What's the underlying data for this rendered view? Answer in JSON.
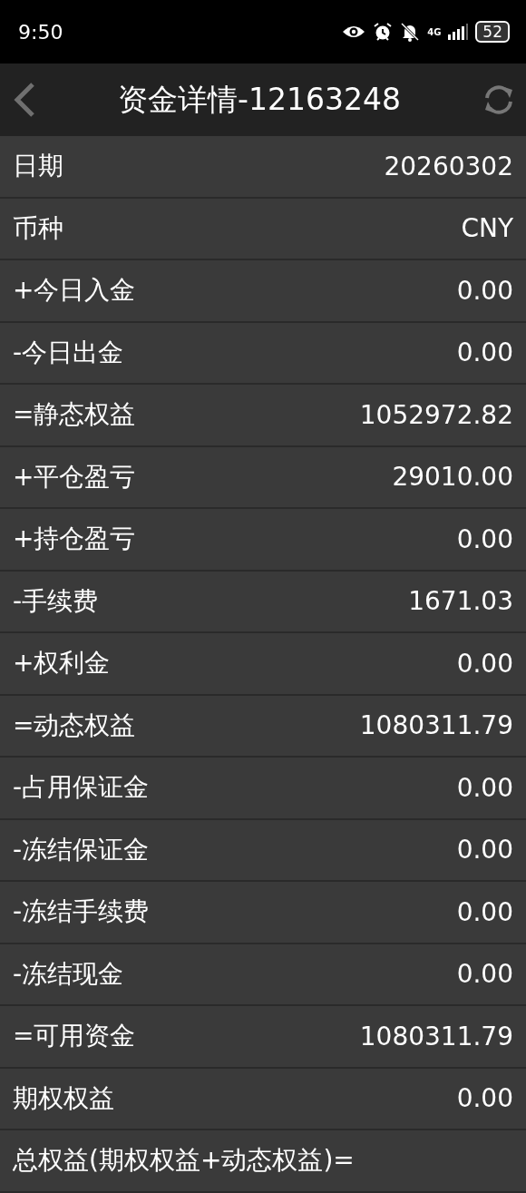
{
  "status_bar": {
    "time": "9:50",
    "network": "4G",
    "battery": "52"
  },
  "header": {
    "title": "资金详情-12163248"
  },
  "rows": [
    {
      "label": "日期",
      "value": "20260302"
    },
    {
      "label": "币种",
      "value": "CNY"
    },
    {
      "label": "+今日入金",
      "value": "0.00"
    },
    {
      "label": "-今日出金",
      "value": "0.00"
    },
    {
      "label": "=静态权益",
      "value": "1052972.82"
    },
    {
      "label": "+平仓盈亏",
      "value": "29010.00"
    },
    {
      "label": "+持仓盈亏",
      "value": "0.00"
    },
    {
      "label": "-手续费",
      "value": "1671.03"
    },
    {
      "label": "+权利金",
      "value": "0.00"
    },
    {
      "label": "=动态权益",
      "value": "1080311.79"
    },
    {
      "label": "-占用保证金",
      "value": "0.00"
    },
    {
      "label": "-冻结保证金",
      "value": "0.00"
    },
    {
      "label": "-冻结手续费",
      "value": "0.00"
    },
    {
      "label": "-冻结现金",
      "value": "0.00"
    },
    {
      "label": "=可用资金",
      "value": "1080311.79"
    },
    {
      "label": "期权权益",
      "value": "0.00"
    },
    {
      "label": "总权益(期权权益+动态权益)="
    }
  ]
}
